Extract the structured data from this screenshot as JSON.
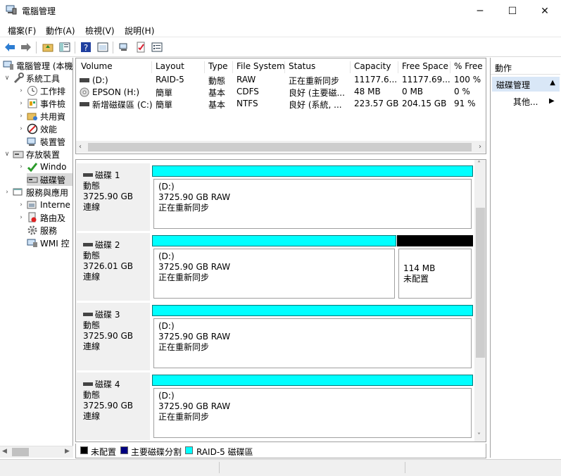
{
  "window": {
    "title": "電腦管理",
    "minimize": "─",
    "maximize": "☐",
    "close": "✕"
  },
  "menu": [
    "檔案(F)",
    "動作(A)",
    "檢視(V)",
    "說明(H)"
  ],
  "tree": {
    "root": "電腦管理 (本機",
    "system_tools": "系統工具",
    "task_scheduler": "工作排",
    "event_viewer": "事件檢",
    "shared_folders": "共用資",
    "performance": "效能",
    "device_manager": "裝置管",
    "storage": "存放裝置",
    "windows_backup": "Windo",
    "disk_management": "磁碟管",
    "services_apps": "服務與應用",
    "internet": "Interne",
    "routing": "路由及",
    "services": "服務",
    "wmi": "WMI 控"
  },
  "volume_list": {
    "columns": [
      "Volume",
      "Layout",
      "Type",
      "File System",
      "Status",
      "Capacity",
      "Free Space",
      "% Free"
    ],
    "rows": [
      [
        "(D:)",
        "RAID-5",
        "動態",
        "RAW",
        "正在重新同步",
        "11177.6...",
        "11177.69...",
        "100 %"
      ],
      [
        "EPSON (H:)",
        "簡單",
        "基本",
        "CDFS",
        "良好 (主要磁...",
        "48 MB",
        "0 MB",
        "0 %"
      ],
      [
        "新增磁碟區 (C:)",
        "簡單",
        "基本",
        "NTFS",
        "良好 (系統, ...",
        "223.57 GB",
        "204.15 GB",
        "91 %"
      ]
    ]
  },
  "disks": [
    {
      "name": "磁碟 1",
      "type": "動態",
      "size": "3725.90 GB",
      "status": "連線",
      "partitions": [
        {
          "label": "(D:)",
          "size": "3725.90 GB RAW",
          "status": "正在重新同步",
          "kind": "raid5"
        }
      ]
    },
    {
      "name": "磁碟 2",
      "type": "動態",
      "size": "3726.01 GB",
      "status": "連線",
      "partitions": [
        {
          "label": "(D:)",
          "size": "3725.90 GB RAW",
          "status": "正在重新同步",
          "kind": "raid5"
        },
        {
          "label": "",
          "size": "114 MB",
          "status": "未配置",
          "kind": "unallocated"
        }
      ]
    },
    {
      "name": "磁碟 3",
      "type": "動態",
      "size": "3725.90 GB",
      "status": "連線",
      "partitions": [
        {
          "label": "(D:)",
          "size": "3725.90 GB RAW",
          "status": "正在重新同步",
          "kind": "raid5"
        }
      ]
    },
    {
      "name": "磁碟 4",
      "type": "動態",
      "size": "3725.90 GB",
      "status": "連線",
      "partitions": [
        {
          "label": "(D:)",
          "size": "3725.90 GB RAW",
          "status": "正在重新同步",
          "kind": "raid5"
        }
      ]
    }
  ],
  "legend": [
    {
      "label": "未配置",
      "color": "#000000"
    },
    {
      "label": "主要磁碟分割",
      "color": "#000080"
    },
    {
      "label": "RAID-5 磁碟區",
      "color": "#00ffff"
    }
  ],
  "actions": {
    "header": "動作",
    "selected": "磁碟管理",
    "more": "其他..."
  }
}
